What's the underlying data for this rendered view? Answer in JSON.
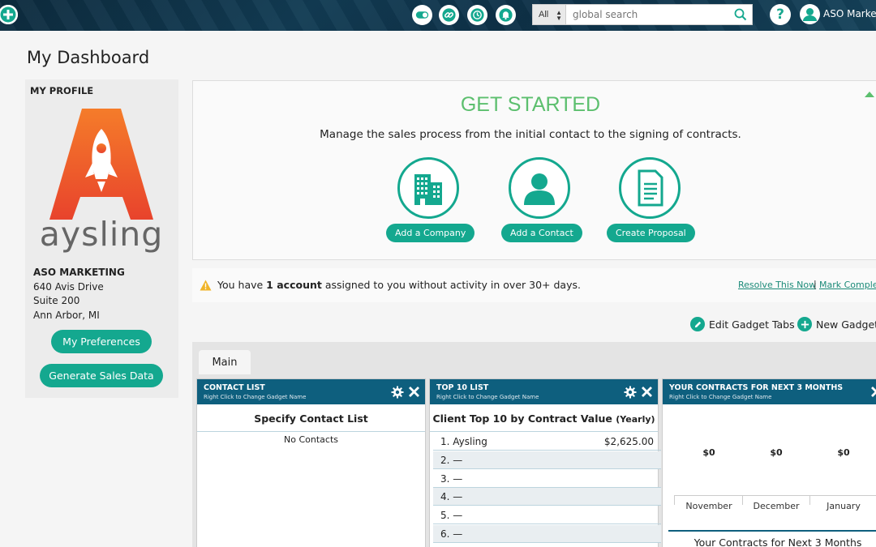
{
  "topbar": {
    "search_scope": "All",
    "search_placeholder": "global search",
    "help_symbol": "?",
    "user_name": "ASO Marketing",
    "icons": [
      "add-icon",
      "toggle-icon",
      "link-icon",
      "history-icon",
      "bell-icon",
      "search-icon",
      "help-icon",
      "user-avatar-icon"
    ]
  },
  "page_title": "My Dashboard",
  "profile": {
    "heading": "MY PROFILE",
    "logo_text": "aysling",
    "company": "ASO MARKETING",
    "address1": "640 Avis Drive",
    "address2": "Suite 200",
    "city": "Ann Arbor, MI",
    "preferences_label": "My Preferences",
    "generate_label": "Generate Sales Data"
  },
  "get_started": {
    "title": "GET STARTED",
    "subtitle": "Manage the sales process from the initial contact to the signing of contracts.",
    "actions": [
      {
        "label": "Add a Company",
        "icon": "building-icon"
      },
      {
        "label": "Add a Contact",
        "icon": "person-icon"
      },
      {
        "label": "Create Proposal",
        "icon": "document-icon"
      }
    ]
  },
  "alert": {
    "prefix": "You have ",
    "bold": "1 account",
    "suffix": " assigned to you without activity in over 30+ days.",
    "resolve_link": "Resolve This Now",
    "separator": "|",
    "complete_link": "Mark Complete"
  },
  "gadget_actions": {
    "edit_tabs": "Edit Gadget Tabs",
    "new_gadget": "New Gadget"
  },
  "tabs": [
    {
      "label": "Main",
      "active": true
    }
  ],
  "gadgets": {
    "contact_list": {
      "title": "CONTACT LIST",
      "subtitle": "Right Click to Change Gadget Name",
      "caption": "Specify Contact List",
      "empty": "No Contacts"
    },
    "top10": {
      "title": "TOP 10 LIST",
      "subtitle": "Right Click to Change Gadget Name",
      "caption": "Client Top 10 by Contract Value",
      "caption_suffix": "(Yearly)",
      "rows": [
        {
          "label": "1. Aysling",
          "value": "$2,625.00"
        },
        {
          "label": "2. —",
          "value": ""
        },
        {
          "label": "3. —",
          "value": ""
        },
        {
          "label": "4. —",
          "value": ""
        },
        {
          "label": "5. —",
          "value": ""
        },
        {
          "label": "6. —",
          "value": ""
        }
      ]
    },
    "contracts": {
      "title": "YOUR CONTRACTS FOR NEXT 3 MONTHS",
      "subtitle": "Right Click to Change Gadget Name",
      "caption": "Your Contracts for Next 3 Months"
    }
  },
  "chart_data": {
    "type": "bar",
    "categories": [
      "November",
      "December",
      "January"
    ],
    "values": [
      0,
      0,
      0
    ],
    "data_labels": [
      "$0",
      "$0",
      "$0"
    ],
    "title": "Your Contracts for Next 3 Months"
  },
  "colors": {
    "accent": "#14a88f",
    "gadget_header": "#0e5f7e",
    "get_started_title": "#5cbf6e",
    "topbar": "#0d2b3e"
  }
}
